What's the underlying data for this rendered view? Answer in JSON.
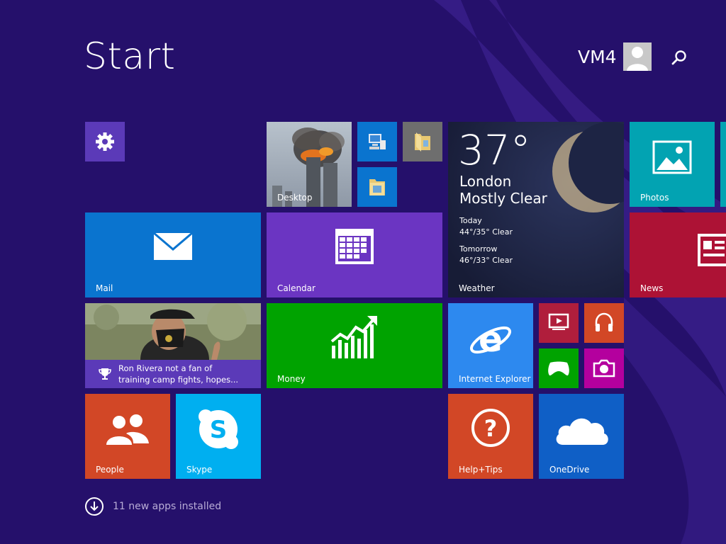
{
  "header": {
    "title": "Start",
    "user_name": "VM4"
  },
  "tiles": {
    "settings": {
      "label": ""
    },
    "desktop": {
      "label": "Desktop"
    },
    "mail": {
      "label": "Mail"
    },
    "calendar": {
      "label": "Calendar"
    },
    "weather": {
      "label": "Weather",
      "temp": "37°",
      "city": "London",
      "condition": "Mostly Clear",
      "today_label": "Today",
      "today_forecast": "44°/35° Clear",
      "tomorrow_label": "Tomorrow",
      "tomorrow_forecast": "46°/33° Clear"
    },
    "photos": {
      "label": "Photos"
    },
    "news": {
      "label": "News"
    },
    "sports": {
      "headline_line1": "Ron Rivera not a fan of",
      "headline_line2": "training camp fights, hopes..."
    },
    "money": {
      "label": "Money"
    },
    "ie": {
      "label": "Internet Explorer"
    },
    "people": {
      "label": "People"
    },
    "skype": {
      "label": "Skype"
    },
    "help": {
      "label": "Help+Tips"
    },
    "onedrive": {
      "label": "OneDrive"
    }
  },
  "footer": {
    "text": "11 new apps installed"
  },
  "colors": {
    "background": "#25106b",
    "settings": "#5b3ab8",
    "mail": "#0a74cf",
    "calendar": "#6b35c2",
    "photos": "#02a3b2",
    "news": "#ad1235",
    "money": "#00a300",
    "ie": "#2d89ef",
    "video": "#b01e3c",
    "music": "#d24726",
    "games": "#00a300",
    "camera": "#b4009e",
    "people": "#d24726",
    "skype": "#00aff0",
    "help": "#d24726",
    "onedrive": "#0f5fc6"
  }
}
